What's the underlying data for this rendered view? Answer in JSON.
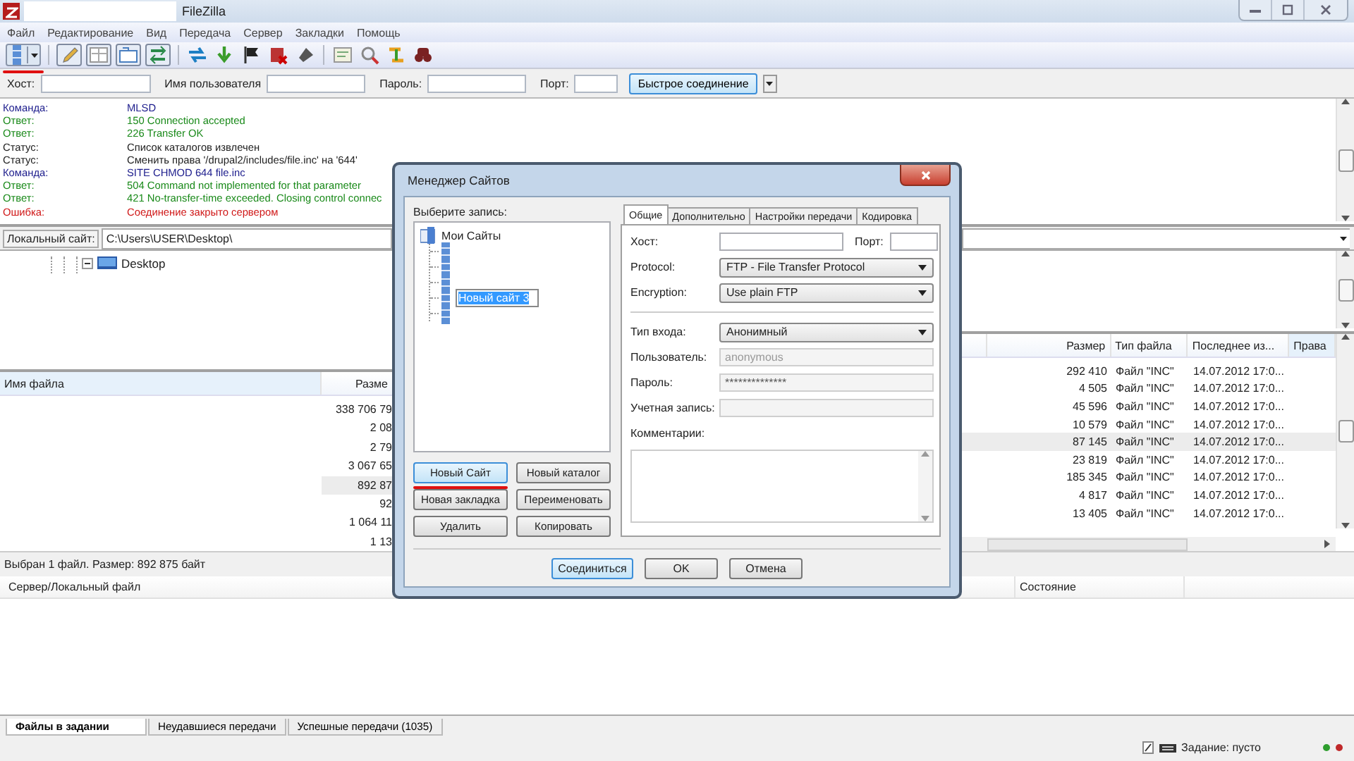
{
  "window": {
    "title": "FileZilla"
  },
  "menu": [
    "Файл",
    "Редактирование",
    "Вид",
    "Передача",
    "Сервер",
    "Закладки",
    "Помощь"
  ],
  "toolbar": {
    "site_manager_annotated": true,
    "toggles": [
      {
        "pressed": true
      },
      {
        "pressed": true
      },
      {
        "pressed": true
      },
      {
        "pressed": true
      }
    ]
  },
  "quickconnect": {
    "host_label": "Хост:",
    "user_label": "Имя пользователя",
    "password_label": "Пароль:",
    "port_label": "Порт:",
    "connect_button": "Быстрое соединение"
  },
  "log": [
    {
      "kind": "command",
      "label": "Команда:",
      "text": "MLSD"
    },
    {
      "kind": "response",
      "label": "Ответ:",
      "text": "150 Connection accepted"
    },
    {
      "kind": "response",
      "label": "Ответ:",
      "text": "226 Transfer OK"
    },
    {
      "kind": "status",
      "label": "Статус:",
      "text": "Список каталогов извлечен"
    },
    {
      "kind": "status",
      "label": "Статус:",
      "text": "Сменить права '/drupal2/includes/file.inc' на '644'"
    },
    {
      "kind": "command",
      "label": "Команда:",
      "text": "SITE CHMOD 644 file.inc"
    },
    {
      "kind": "response",
      "label": "Ответ:",
      "text": "504 Command not implemented for that parameter"
    },
    {
      "kind": "response",
      "label": "Ответ:",
      "text": "421 No-transfer-time exceeded. Closing control connec"
    },
    {
      "kind": "error",
      "label": "Ошибка:",
      "text": "Соединение закрыто сервером"
    }
  ],
  "local_site": {
    "label": "Локальный сайт:",
    "path": "C:\\Users\\USER\\Desktop\\",
    "tree": [
      {
        "name": "Desktop",
        "expanded": true
      }
    ]
  },
  "local_files": {
    "columns": [
      "Имя файла",
      "Разме"
    ],
    "rows": [
      {
        "size": "338 706 79",
        "selected": false
      },
      {
        "size": "2 08",
        "selected": false
      },
      {
        "size": "2 79",
        "selected": false
      },
      {
        "size": "3 067 65",
        "selected": false
      },
      {
        "size": "892 87",
        "selected": true
      },
      {
        "size": "92",
        "selected": false
      },
      {
        "size": "1 064 11",
        "selected": false
      },
      {
        "size": "1 13",
        "selected": false
      }
    ]
  },
  "remote_files": {
    "columns": [
      "Размер",
      "Тип файла",
      "Последнее из...",
      "Права"
    ],
    "rows": [
      {
        "size": "292 410",
        "type": "Файл \"INC\"",
        "modified": "14.07.2012 17:0...",
        "selected": false
      },
      {
        "size": "4 505",
        "type": "Файл \"INC\"",
        "modified": "14.07.2012 17:0...",
        "selected": false
      },
      {
        "size": "45 596",
        "type": "Файл \"INC\"",
        "modified": "14.07.2012 17:0...",
        "selected": false
      },
      {
        "size": "10 579",
        "type": "Файл \"INC\"",
        "modified": "14.07.2012 17:0...",
        "selected": false
      },
      {
        "size": "87 145",
        "type": "Файл \"INC\"",
        "modified": "14.07.2012 17:0...",
        "selected": true
      },
      {
        "size": "23 819",
        "type": "Файл \"INC\"",
        "modified": "14.07.2012 17:0...",
        "selected": false
      },
      {
        "size": "185 345",
        "type": "Файл \"INC\"",
        "modified": "14.07.2012 17:0...",
        "selected": false
      },
      {
        "size": "4 817",
        "type": "Файл \"INC\"",
        "modified": "14.07.2012 17:0...",
        "selected": false
      },
      {
        "size": "13 405",
        "type": "Файл \"INC\"",
        "modified": "14.07.2012 17:0...",
        "selected": false
      }
    ]
  },
  "local_status": "Выбран 1 файл. Размер: 892 875 байт",
  "queue": {
    "columns": [
      "Сервер/Локальный файл",
      "Состояние"
    ],
    "tabs": [
      {
        "label": "Файлы в задании",
        "selected": true
      },
      {
        "label": "Неудавшиеся передачи",
        "selected": false
      },
      {
        "label": "Успешные передачи (1035)",
        "selected": false
      }
    ]
  },
  "status_bar": {
    "queue_text": "Задание: пусто",
    "lights": [
      {
        "color": "#2e9e2e"
      },
      {
        "color": "#c0282a"
      }
    ]
  },
  "site_manager": {
    "title": "Менеджер Сайтов",
    "tree_label": "Выберите запись:",
    "root": {
      "name": "Мои Сайты",
      "expanded": true,
      "children": [
        {
          "kind": "server"
        },
        {
          "kind": "server"
        },
        {
          "kind": "server"
        },
        {
          "kind": "server",
          "rename_value": "Новый сайт 3"
        },
        {
          "kind": "server"
        }
      ]
    },
    "buttons": [
      {
        "label": "Новый Сайт",
        "focused": true,
        "annotated": true
      },
      {
        "label": "Новый каталог",
        "focused": false,
        "annotated": false
      },
      {
        "label": "Новая закладка",
        "focused": false,
        "annotated": false
      },
      {
        "label": "Переименовать",
        "focused": false,
        "annotated": false
      },
      {
        "label": "Удалить",
        "focused": false,
        "annotated": false
      },
      {
        "label": "Копировать",
        "focused": false,
        "annotated": false
      }
    ],
    "tabs": [
      {
        "label": "Общие",
        "selected": true
      },
      {
        "label": "Дополнительно",
        "selected": false
      },
      {
        "label": "Настройки передачи",
        "selected": false
      },
      {
        "label": "Кодировка",
        "selected": false
      }
    ],
    "fields": [
      {
        "kind": "host",
        "label": "Хост:",
        "port_label": "Порт:"
      },
      {
        "kind": "select",
        "label": "Protocol:",
        "value": "FTP - File Transfer Protocol"
      },
      {
        "kind": "select",
        "label": "Encryption:",
        "value": "Use plain FTP"
      },
      {
        "kind": "separator"
      },
      {
        "kind": "select",
        "label": "Тип входа:",
        "value": "Анонимный"
      },
      {
        "kind": "text",
        "label": "Пользователь:",
        "value": "anonymous",
        "disabled": true
      },
      {
        "kind": "text",
        "label": "Пароль:",
        "value": "**************",
        "disabled": true
      },
      {
        "kind": "text",
        "label": "Учетная запись:",
        "disabled": true
      },
      {
        "kind": "textarea",
        "label": "Комментарии:"
      }
    ],
    "footer_buttons": [
      {
        "label": "Соединиться",
        "default": true
      },
      {
        "label": "OK",
        "default": false
      },
      {
        "label": "Отмена",
        "default": false
      }
    ]
  }
}
